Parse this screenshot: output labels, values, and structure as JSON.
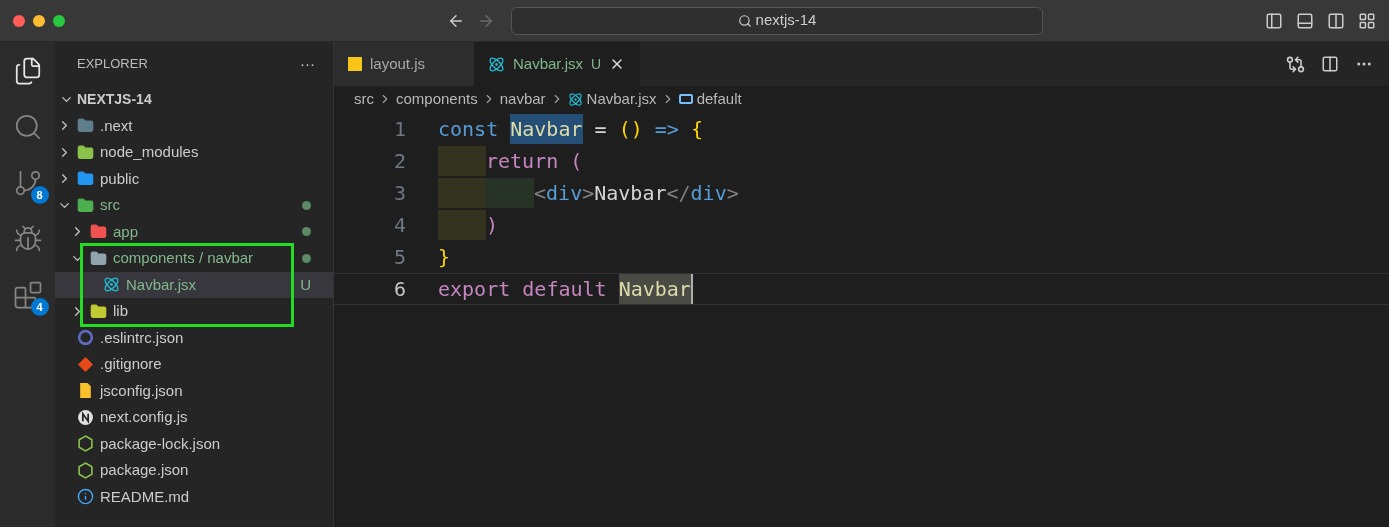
{
  "title_bar": {
    "search": "nextjs-14"
  },
  "activity_bar": [
    {
      "kind": "files",
      "selected": true
    },
    {
      "kind": "search",
      "selected": false
    },
    {
      "kind": "source-control",
      "selected": false,
      "badge": "8"
    },
    {
      "kind": "debug",
      "selected": false
    },
    {
      "kind": "extensions",
      "selected": false,
      "badge": "4"
    }
  ],
  "explorer": {
    "title": "EXPLORER",
    "more": "···",
    "root": {
      "label": "NEXTJS-14",
      "expanded": true
    },
    "items": [
      {
        "label": ".next",
        "kind": "next-folder",
        "expanded": false,
        "changed": false,
        "modified": false
      },
      {
        "label": "node_modules",
        "kind": "node-folder",
        "expanded": false,
        "changed": false,
        "modified": false
      },
      {
        "label": "public",
        "kind": "public-folder",
        "expanded": false,
        "changed": false,
        "modified": false
      },
      {
        "label": "src",
        "kind": "src-folder",
        "expanded": true,
        "changed": true,
        "modified": true,
        "children": [
          {
            "label": "app",
            "kind": "app-folder",
            "expanded": false,
            "changed": true,
            "modified": true,
            "outlined": false
          },
          {
            "label": "components / navbar",
            "kind": "folder",
            "expanded": true,
            "changed": true,
            "modified": true,
            "outlined": true,
            "children": [
              {
                "label": "Navbar.jsx",
                "kind": "react-file",
                "changed": true,
                "modified": false,
                "badge": "U",
                "selected": true,
                "outlined": true
              }
            ]
          },
          {
            "label": "lib",
            "kind": "lib-folder",
            "expanded": false,
            "changed": false,
            "modified": false,
            "outlined": true
          }
        ]
      },
      {
        "label": ".eslintrc.json",
        "kind": "eslint-file",
        "changed": false,
        "modified": false
      },
      {
        "label": ".gitignore",
        "kind": "git-file",
        "changed": false,
        "modified": false
      },
      {
        "label": "jsconfig.json",
        "kind": "jsconfig-file",
        "changed": false,
        "modified": false
      },
      {
        "label": "next.config.js",
        "kind": "next-file",
        "changed": false,
        "modified": false
      },
      {
        "label": "package-lock.json",
        "kind": "node-file",
        "changed": false,
        "modified": false
      },
      {
        "label": "package.json",
        "kind": "node-file",
        "changed": false,
        "modified": false
      },
      {
        "label": "README.md",
        "kind": "info-file",
        "changed": false,
        "modified": false
      }
    ]
  },
  "tabs": [
    {
      "label": "layout.js",
      "kind": "js",
      "selected": false,
      "changed": false
    },
    {
      "label": "Navbar.jsx",
      "kind": "react",
      "selected": true,
      "changed": true,
      "badge": "U"
    }
  ],
  "breadcrumbs": [
    {
      "label": "src",
      "kind": "text"
    },
    {
      "label": "components",
      "kind": "text"
    },
    {
      "label": "navbar",
      "kind": "text"
    },
    {
      "label": "Navbar.jsx",
      "kind": "react"
    },
    {
      "label": "default",
      "kind": "symbol"
    }
  ],
  "code": [
    {
      "number": "1",
      "current": false,
      "tokens": [
        {
          "t": "const ",
          "kind": "keyword"
        },
        {
          "t": "Navbar",
          "kind": "name-hl"
        },
        {
          "t": " = ",
          "kind": "op"
        },
        {
          "t": "()",
          "kind": "paren"
        },
        {
          "t": " => ",
          "kind": "keyword"
        },
        {
          "t": "{",
          "kind": "paren"
        }
      ]
    },
    {
      "number": "2",
      "current": false,
      "indent_guides": [
        {
          "kind": "outer"
        }
      ],
      "tokens": [
        {
          "t": "return ",
          "kind": "control"
        },
        {
          "t": "(",
          "kind": "control"
        }
      ]
    },
    {
      "number": "3",
      "current": false,
      "indent_guides": [
        {
          "kind": "outer"
        },
        {
          "kind": "inner"
        }
      ],
      "tokens": [
        {
          "t": "<",
          "kind": "punct"
        },
        {
          "t": "div",
          "kind": "tag"
        },
        {
          "t": ">",
          "kind": "punct"
        },
        {
          "t": "Navbar",
          "kind": "text"
        },
        {
          "t": "</",
          "kind": "punct"
        },
        {
          "t": "div",
          "kind": "tag"
        },
        {
          "t": ">",
          "kind": "punct"
        }
      ]
    },
    {
      "number": "4",
      "current": false,
      "indent_guides": [
        {
          "kind": "outer"
        }
      ],
      "tokens": [
        {
          "t": ")",
          "kind": "control"
        }
      ]
    },
    {
      "number": "5",
      "current": false,
      "tokens": [
        {
          "t": "}",
          "kind": "paren"
        }
      ]
    },
    {
      "number": "6",
      "current": true,
      "tokens": [
        {
          "t": "export ",
          "kind": "control"
        },
        {
          "t": "default ",
          "kind": "control"
        },
        {
          "t": "Navbar",
          "kind": "name-sel"
        }
      ]
    }
  ]
}
